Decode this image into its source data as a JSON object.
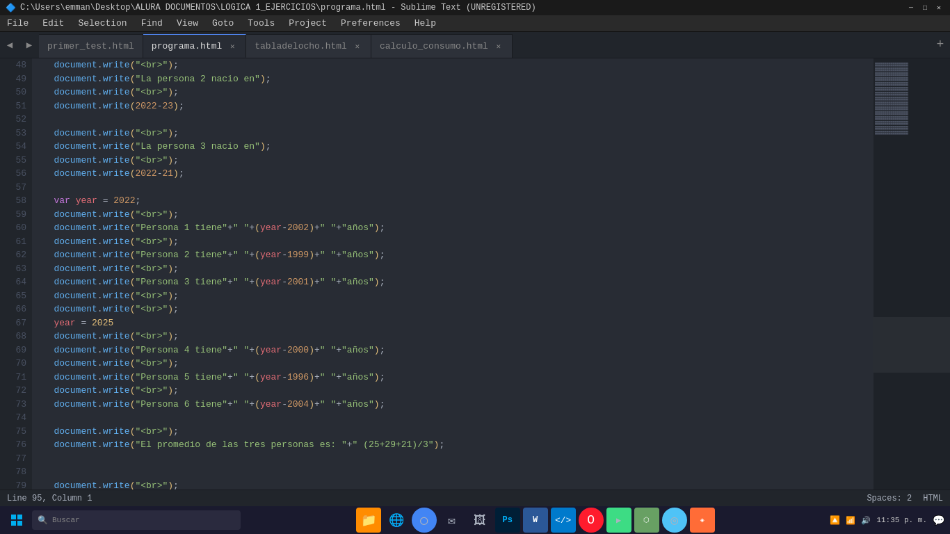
{
  "titlebar": {
    "title": "C:\\Users\\emman\\Desktop\\ALURA DOCUMENTOS\\LOGICA 1_EJERCICIOS\\programa.html - Sublime Text (UNREGISTERED)",
    "min": "─",
    "max": "□",
    "close": "✕"
  },
  "menubar": {
    "items": [
      "File",
      "Edit",
      "Selection",
      "Find",
      "View",
      "Goto",
      "Tools",
      "Project",
      "Preferences",
      "Help"
    ]
  },
  "tabs": [
    {
      "label": "primer_test.html",
      "active": false,
      "closable": false
    },
    {
      "label": "programa.html",
      "active": true,
      "closable": true
    },
    {
      "label": "tabladelocho.html",
      "active": false,
      "closable": true
    },
    {
      "label": "calculo_consumo.html",
      "active": false,
      "closable": true
    }
  ],
  "statusbar": {
    "position": "Line 95, Column 1",
    "spaces": "Spaces: 2",
    "syntax": "HTML"
  },
  "taskbar": {
    "time": "11:35 p. m.",
    "search_placeholder": "Buscar"
  }
}
